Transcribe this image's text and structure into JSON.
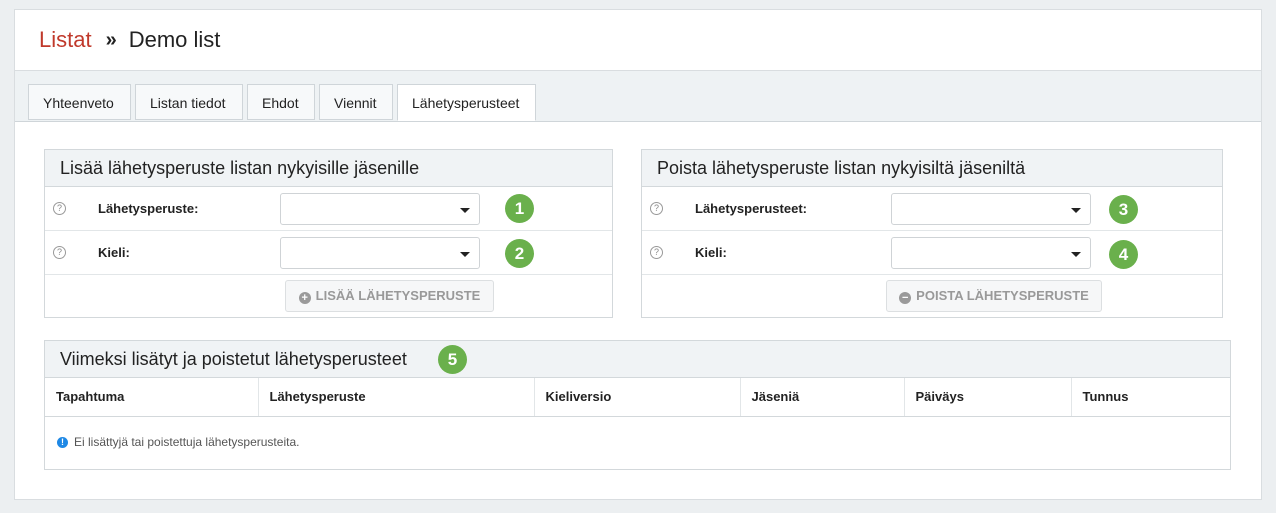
{
  "breadcrumb": {
    "parent": "Listat",
    "separator": "»",
    "current": "Demo list"
  },
  "tabs": [
    {
      "label": "Yhteenveto"
    },
    {
      "label": "Listan tiedot"
    },
    {
      "label": "Ehdot"
    },
    {
      "label": "Viennit"
    },
    {
      "label": "Lähetysperusteet",
      "active": true
    }
  ],
  "add_panel": {
    "title": "Lisää lähetysperuste listan nykyisille jäsenille",
    "field1_label": "Lähetysperuste:",
    "field1_value": "",
    "field2_label": "Kieli:",
    "field2_value": "",
    "button_label": "LISÄÄ LÄHETYSPERUSTE",
    "badge1": "1",
    "badge2": "2"
  },
  "remove_panel": {
    "title": "Poista lähetysperuste listan nykyisiltä jäseniltä",
    "field1_label": "Lähetysperusteet:",
    "field1_value": "",
    "field2_label": "Kieli:",
    "field2_value": "",
    "button_label": "POISTA LÄHETYSPERUSTE",
    "badge3": "3",
    "badge4": "4"
  },
  "recent_panel": {
    "title": "Viimeksi lisätyt ja poistetut lähetysperusteet",
    "badge5": "5",
    "columns": [
      "Tapahtuma",
      "Lähetysperuste",
      "Kieliversio",
      "Jäseniä",
      "Päiväys",
      "Tunnus"
    ],
    "empty_message": "Ei lisättyjä tai poistettuja lähetysperusteita."
  },
  "colors": {
    "link": "#c0392b",
    "badge": "#6ab04c",
    "info": "#1e88e5"
  }
}
